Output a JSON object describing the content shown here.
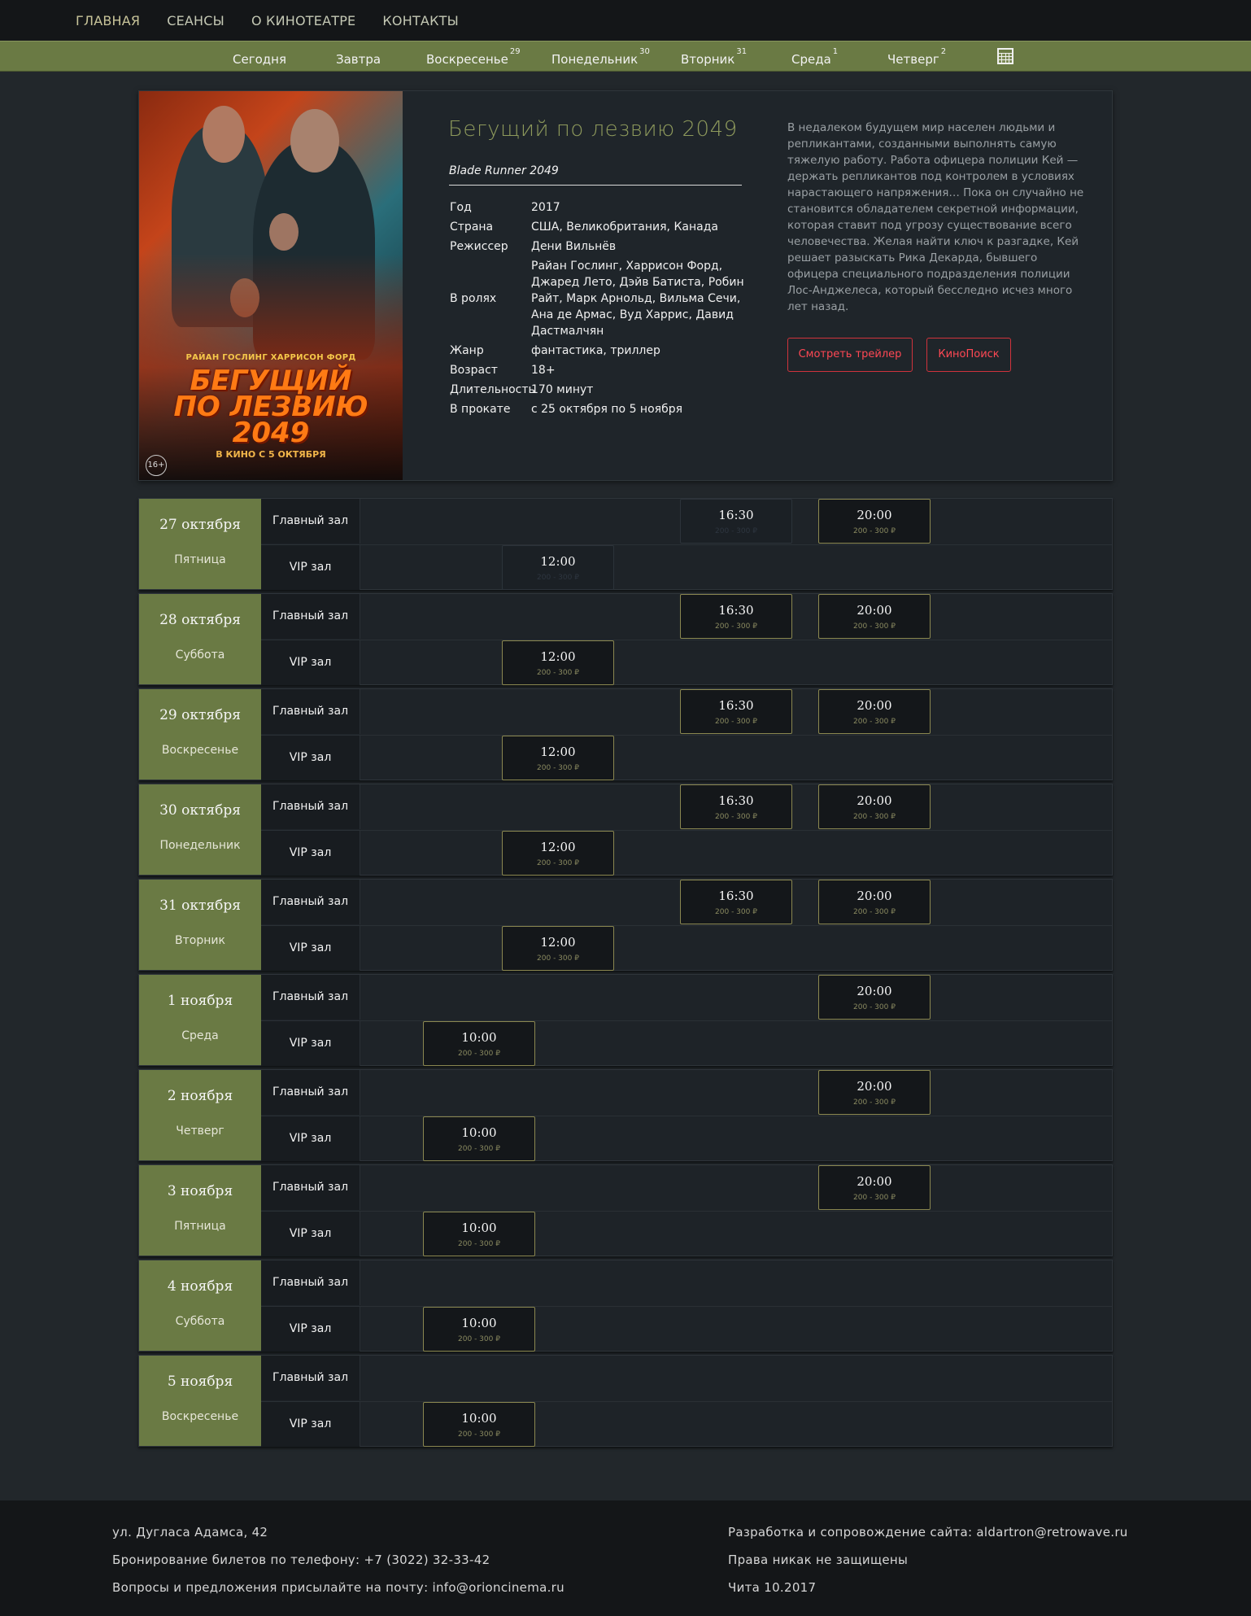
{
  "nav": [
    "ГЛАВНАЯ",
    "СЕАНСЫ",
    "О КИНОТЕАТРЕ",
    "КОНТАКТЫ"
  ],
  "days": [
    {
      "label": "Сегодня",
      "num": ""
    },
    {
      "label": "Завтра",
      "num": ""
    },
    {
      "label": "Воскресенье",
      "num": "29"
    },
    {
      "label": "Понедельник",
      "num": "30"
    },
    {
      "label": "Вторник",
      "num": "31"
    },
    {
      "label": "Среда",
      "num": "1"
    },
    {
      "label": "Четверг",
      "num": "2"
    }
  ],
  "movie": {
    "title": "Бегущий по лезвию 2049",
    "original_title": "Blade Runner 2049",
    "poster": {
      "actors": "РАЙАН ГОСЛИНГ   ХАРРИСОН ФОРД",
      "title_line1": "БЕГУЩИЙ",
      "title_line2": "ПО ЛЕЗВИЮ",
      "title_line3": "2049",
      "subtitle": "В КИНО С 5 ОКТЯБРЯ",
      "age": "16+"
    },
    "info": [
      {
        "k": "Год",
        "v": "2017"
      },
      {
        "k": "Страна",
        "v": "США, Великобритания, Канада"
      },
      {
        "k": "Режиссер",
        "v": "Дени Вильнёв"
      },
      {
        "k": "В ролях",
        "v": "Райан Гослинг, Харрисон Форд, Джаред Лето, Дэйв Батиста, Робин Райт, Марк Арнольд, Вильма Сечи, Ана де Армас, Вуд Харрис, Давид Дастмалчян"
      },
      {
        "k": "Жанр",
        "v": "фантастика, триллер"
      },
      {
        "k": "Возраст",
        "v": "18+"
      },
      {
        "k": "Длительность",
        "v": "170 минут"
      },
      {
        "k": "В прокате",
        "v": "с 25 октября по 5 ноября"
      }
    ],
    "description": "В недалеком будущем мир населен людьми и репликантами, созданными выполнять самую тяжелую работу. Работа офицера полиции Кей — держать репликантов под контролем в условиях нарастающего напряжения… Пока он случайно не становится обладателем секретной информации, которая ставит под угрозу существование всего человечества. Желая найти ключ к разгадке, Кей решает разыскать Рика Декарда, бывшего офицера специального подразделения полиции Лос-Анджелеса, который бесследно исчез много лет назад.",
    "trailer_button": "Смотреть трейлер",
    "kinopoisk_button": "КиноПоиск"
  },
  "halls": {
    "main": "Главный зал",
    "vip": "VIP зал"
  },
  "price": "200 - 300 ₽",
  "schedule": [
    {
      "date": "27 октября",
      "weekday": "Пятница",
      "main": [
        {
          "time": "16:30",
          "col": 1,
          "past": true
        },
        {
          "time": "20:00",
          "col": 2
        }
      ],
      "vip": [
        {
          "time": "12:00",
          "col": 0,
          "past": true
        }
      ]
    },
    {
      "date": "28 октября",
      "weekday": "Суббота",
      "main": [
        {
          "time": "16:30",
          "col": 1
        },
        {
          "time": "20:00",
          "col": 2
        }
      ],
      "vip": [
        {
          "time": "12:00",
          "col": 0
        }
      ]
    },
    {
      "date": "29 октября",
      "weekday": "Воскресенье",
      "main": [
        {
          "time": "16:30",
          "col": 1
        },
        {
          "time": "20:00",
          "col": 2
        }
      ],
      "vip": [
        {
          "time": "12:00",
          "col": 0
        }
      ]
    },
    {
      "date": "30 октября",
      "weekday": "Понедельник",
      "main": [
        {
          "time": "16:30",
          "col": 1
        },
        {
          "time": "20:00",
          "col": 2
        }
      ],
      "vip": [
        {
          "time": "12:00",
          "col": 0
        }
      ]
    },
    {
      "date": "31 октября",
      "weekday": "Вторник",
      "main": [
        {
          "time": "16:30",
          "col": 1
        },
        {
          "time": "20:00",
          "col": 2
        }
      ],
      "vip": [
        {
          "time": "12:00",
          "col": 0
        }
      ]
    },
    {
      "date": "1 ноября",
      "weekday": "Среда",
      "main": [
        {
          "time": "20:00",
          "col": 2
        }
      ],
      "vip": [
        {
          "time": "10:00",
          "col": -1
        }
      ]
    },
    {
      "date": "2 ноября",
      "weekday": "Четверг",
      "main": [
        {
          "time": "20:00",
          "col": 2
        }
      ],
      "vip": [
        {
          "time": "10:00",
          "col": -1
        }
      ]
    },
    {
      "date": "3 ноября",
      "weekday": "Пятница",
      "main": [
        {
          "time": "20:00",
          "col": 2
        }
      ],
      "vip": [
        {
          "time": "10:00",
          "col": -1
        }
      ]
    },
    {
      "date": "4 ноября",
      "weekday": "Суббота",
      "main": [],
      "vip": [
        {
          "time": "10:00",
          "col": -1
        }
      ]
    },
    {
      "date": "5 ноября",
      "weekday": "Воскресенье",
      "main": [],
      "vip": [
        {
          "time": "10:00",
          "col": -1
        }
      ]
    }
  ],
  "footer": {
    "address": "ул. Дугласа Адамса, 42",
    "booking": "Бронирование билетов по телефону: +7 (3022) 32-33-42",
    "feedback": "Вопросы и предложения присылайте на почту: info@orioncinema.ru",
    "dev": "Разработка и сопровождение сайта: aldartron@retrowave.ru",
    "rights": "Права никак не защищены",
    "city": "Чита 10.2017"
  }
}
